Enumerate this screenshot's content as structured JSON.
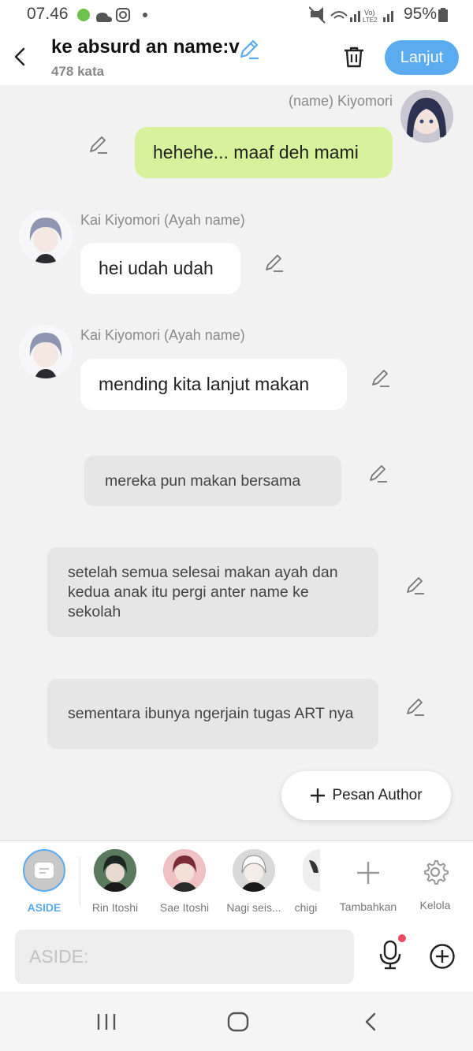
{
  "status_bar": {
    "time": "07.46",
    "battery": "95%"
  },
  "header": {
    "title": "ke absurd an name:v",
    "word_count": "478 kata",
    "next_label": "Lanjut"
  },
  "messages": {
    "m1": {
      "sender": "(name) Kiyomori",
      "text": "hehehe... maaf deh mami"
    },
    "m2": {
      "sender": "Kai Kiyomori (Ayah name)",
      "text": "hei udah udah"
    },
    "m3": {
      "sender": "Kai Kiyomori (Ayah name)",
      "text": "mending kita lanjut makan"
    },
    "n1": {
      "text": "mereka pun makan bersama"
    },
    "n2": {
      "text": "setelah semua selesai makan ayah dan kedua anak itu pergi anter name ke sekolah"
    },
    "n3": {
      "text": "sementara ibunya ngerjain tugas ART nya"
    }
  },
  "fab": {
    "label": "Pesan Author"
  },
  "characters": [
    {
      "label": "ASIDE",
      "selected": true
    },
    {
      "label": "Rin Itoshi"
    },
    {
      "label": "Sae Itoshi"
    },
    {
      "label": "Nagi seis..."
    },
    {
      "label": "chigi"
    }
  ],
  "actions": {
    "add_label": "Tambahkan",
    "manage_label": "Kelola"
  },
  "composer": {
    "placeholder": "ASIDE:"
  },
  "colors": {
    "accent": "#5aabf0",
    "my_bubble": "#d6f29a",
    "background": "#f2f2f2"
  }
}
